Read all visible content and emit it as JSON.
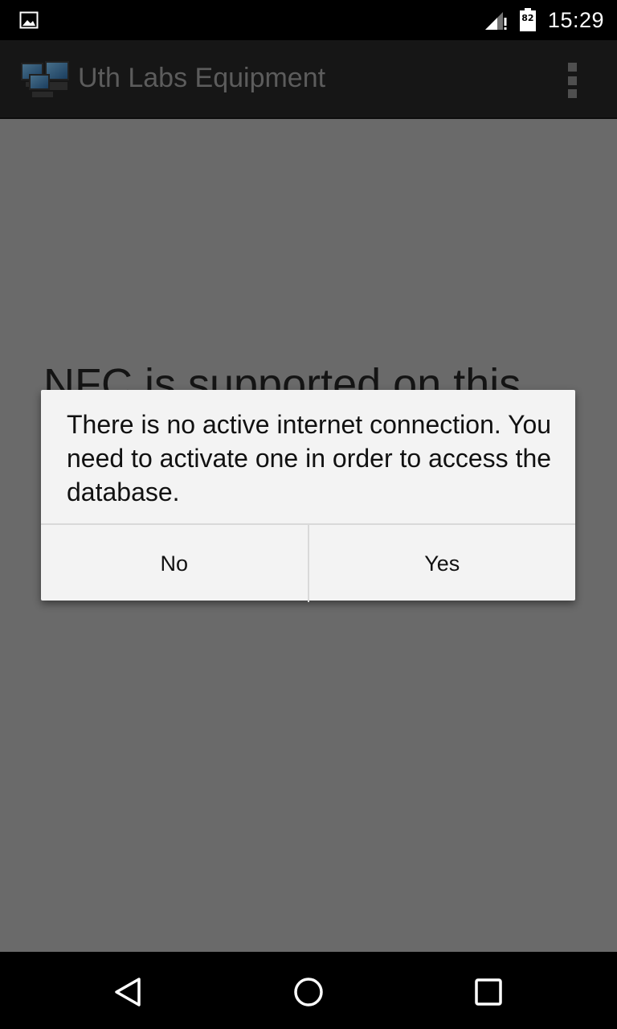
{
  "status_bar": {
    "time": "15:29",
    "battery_level": "82",
    "icons": [
      "gallery-icon",
      "signal-icon",
      "battery-icon"
    ]
  },
  "action_bar": {
    "title": "Uth Labs Equipment",
    "logo": "computers-logo",
    "overflow_icon": "overflow-menu-icon"
  },
  "main": {
    "message": "NFC is supported on this"
  },
  "dialog": {
    "message": "There is no active internet connection. You need to activate one in order to access the database.",
    "no_label": "No",
    "yes_label": "Yes"
  },
  "nav_bar": {
    "icons": [
      "back-icon",
      "home-icon",
      "recents-icon"
    ]
  },
  "colors": {
    "background_dim": "#6a6a6a",
    "action_bar": "#161616",
    "dialog_bg": "#f3f3f3",
    "title_text": "#5c5c5c"
  }
}
